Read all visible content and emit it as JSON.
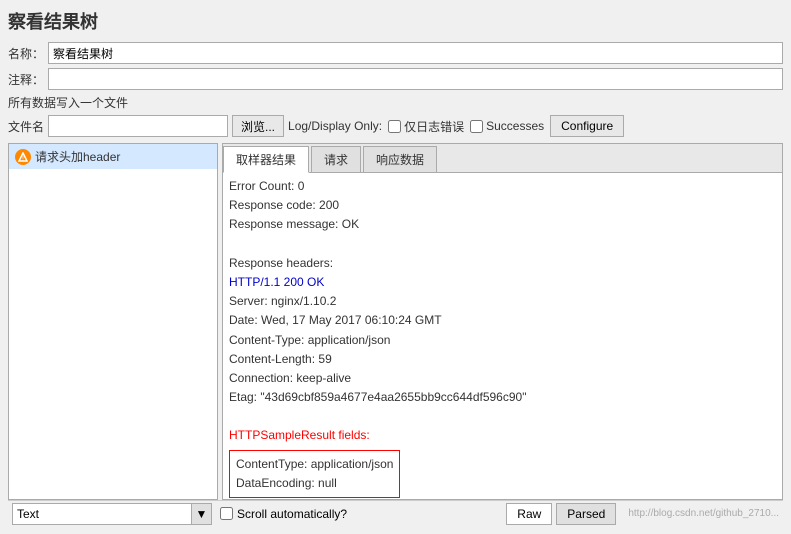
{
  "title": "察看结果树",
  "form": {
    "name_label": "名称：",
    "name_value": "察看结果树",
    "comment_label": "注释：",
    "comment_value": "",
    "all_data_label": "所有数据写入一个文件",
    "file_label": "文件名",
    "file_value": "",
    "browse_label": "浏览...",
    "log_display_label": "Log/Display Only:",
    "log_errors_label": "仅日志错误",
    "successes_label": "Successes",
    "configure_label": "Configure"
  },
  "tree": {
    "items": [
      {
        "id": "item-1",
        "label": "请求头加header",
        "icon": "warning"
      }
    ]
  },
  "tabs": {
    "sampler_result": "取样器结果",
    "request": "请求",
    "response_data": "响应数据"
  },
  "result_content": {
    "lines": [
      "Error Count: 0",
      "Response code: 200",
      "Response message: OK",
      "",
      "Response headers:",
      "HTTP/1.1 200 OK",
      "Server: nginx/1.10.2",
      "Date: Wed, 17 May 2017 06:10:24 GMT",
      "Content-Type: application/json",
      "Content-Length: 59",
      "Connection: keep-alive",
      "Etag: \"43d69cbf859a4677e4aa2655bb9cc644df596c90\""
    ],
    "http_fields_label": "HTTPSampleResult fields:",
    "http_fields": [
      "ContentType: application/json",
      "DataEncoding: null"
    ]
  },
  "bottom": {
    "text_label": "Text",
    "scroll_label": "Scroll automatically?",
    "raw_tab": "Raw",
    "parsed_tab": "Parsed",
    "watermark": "http://blog.csdn.net/github_2710..."
  }
}
